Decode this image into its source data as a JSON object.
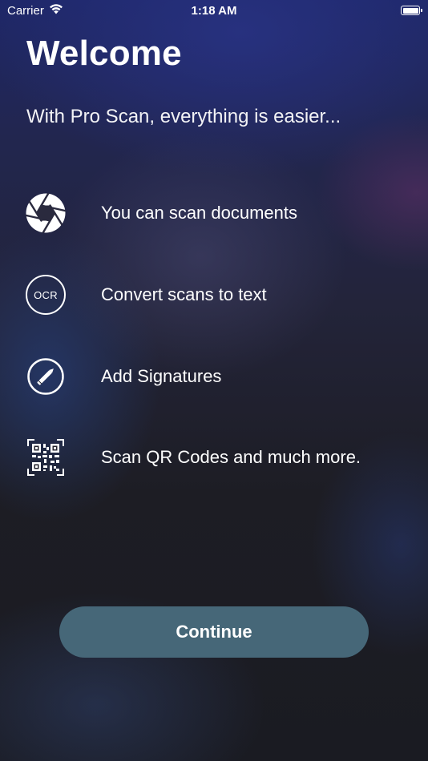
{
  "status_bar": {
    "carrier": "Carrier",
    "time": "1:18 AM"
  },
  "welcome": {
    "title": "Welcome",
    "subtitle": "With Pro Scan, everything is easier..."
  },
  "features": [
    {
      "icon": "camera-shutter-icon",
      "label": "You can scan documents"
    },
    {
      "icon": "ocr-icon",
      "badge_text": "OCR",
      "label": "Convert scans to text"
    },
    {
      "icon": "pencil-icon",
      "label": "Add Signatures"
    },
    {
      "icon": "qr-code-icon",
      "label": "Scan QR Codes and much more."
    }
  ],
  "continue_button": {
    "label": "Continue"
  },
  "colors": {
    "button_background": "#466778",
    "text": "#ffffff"
  }
}
